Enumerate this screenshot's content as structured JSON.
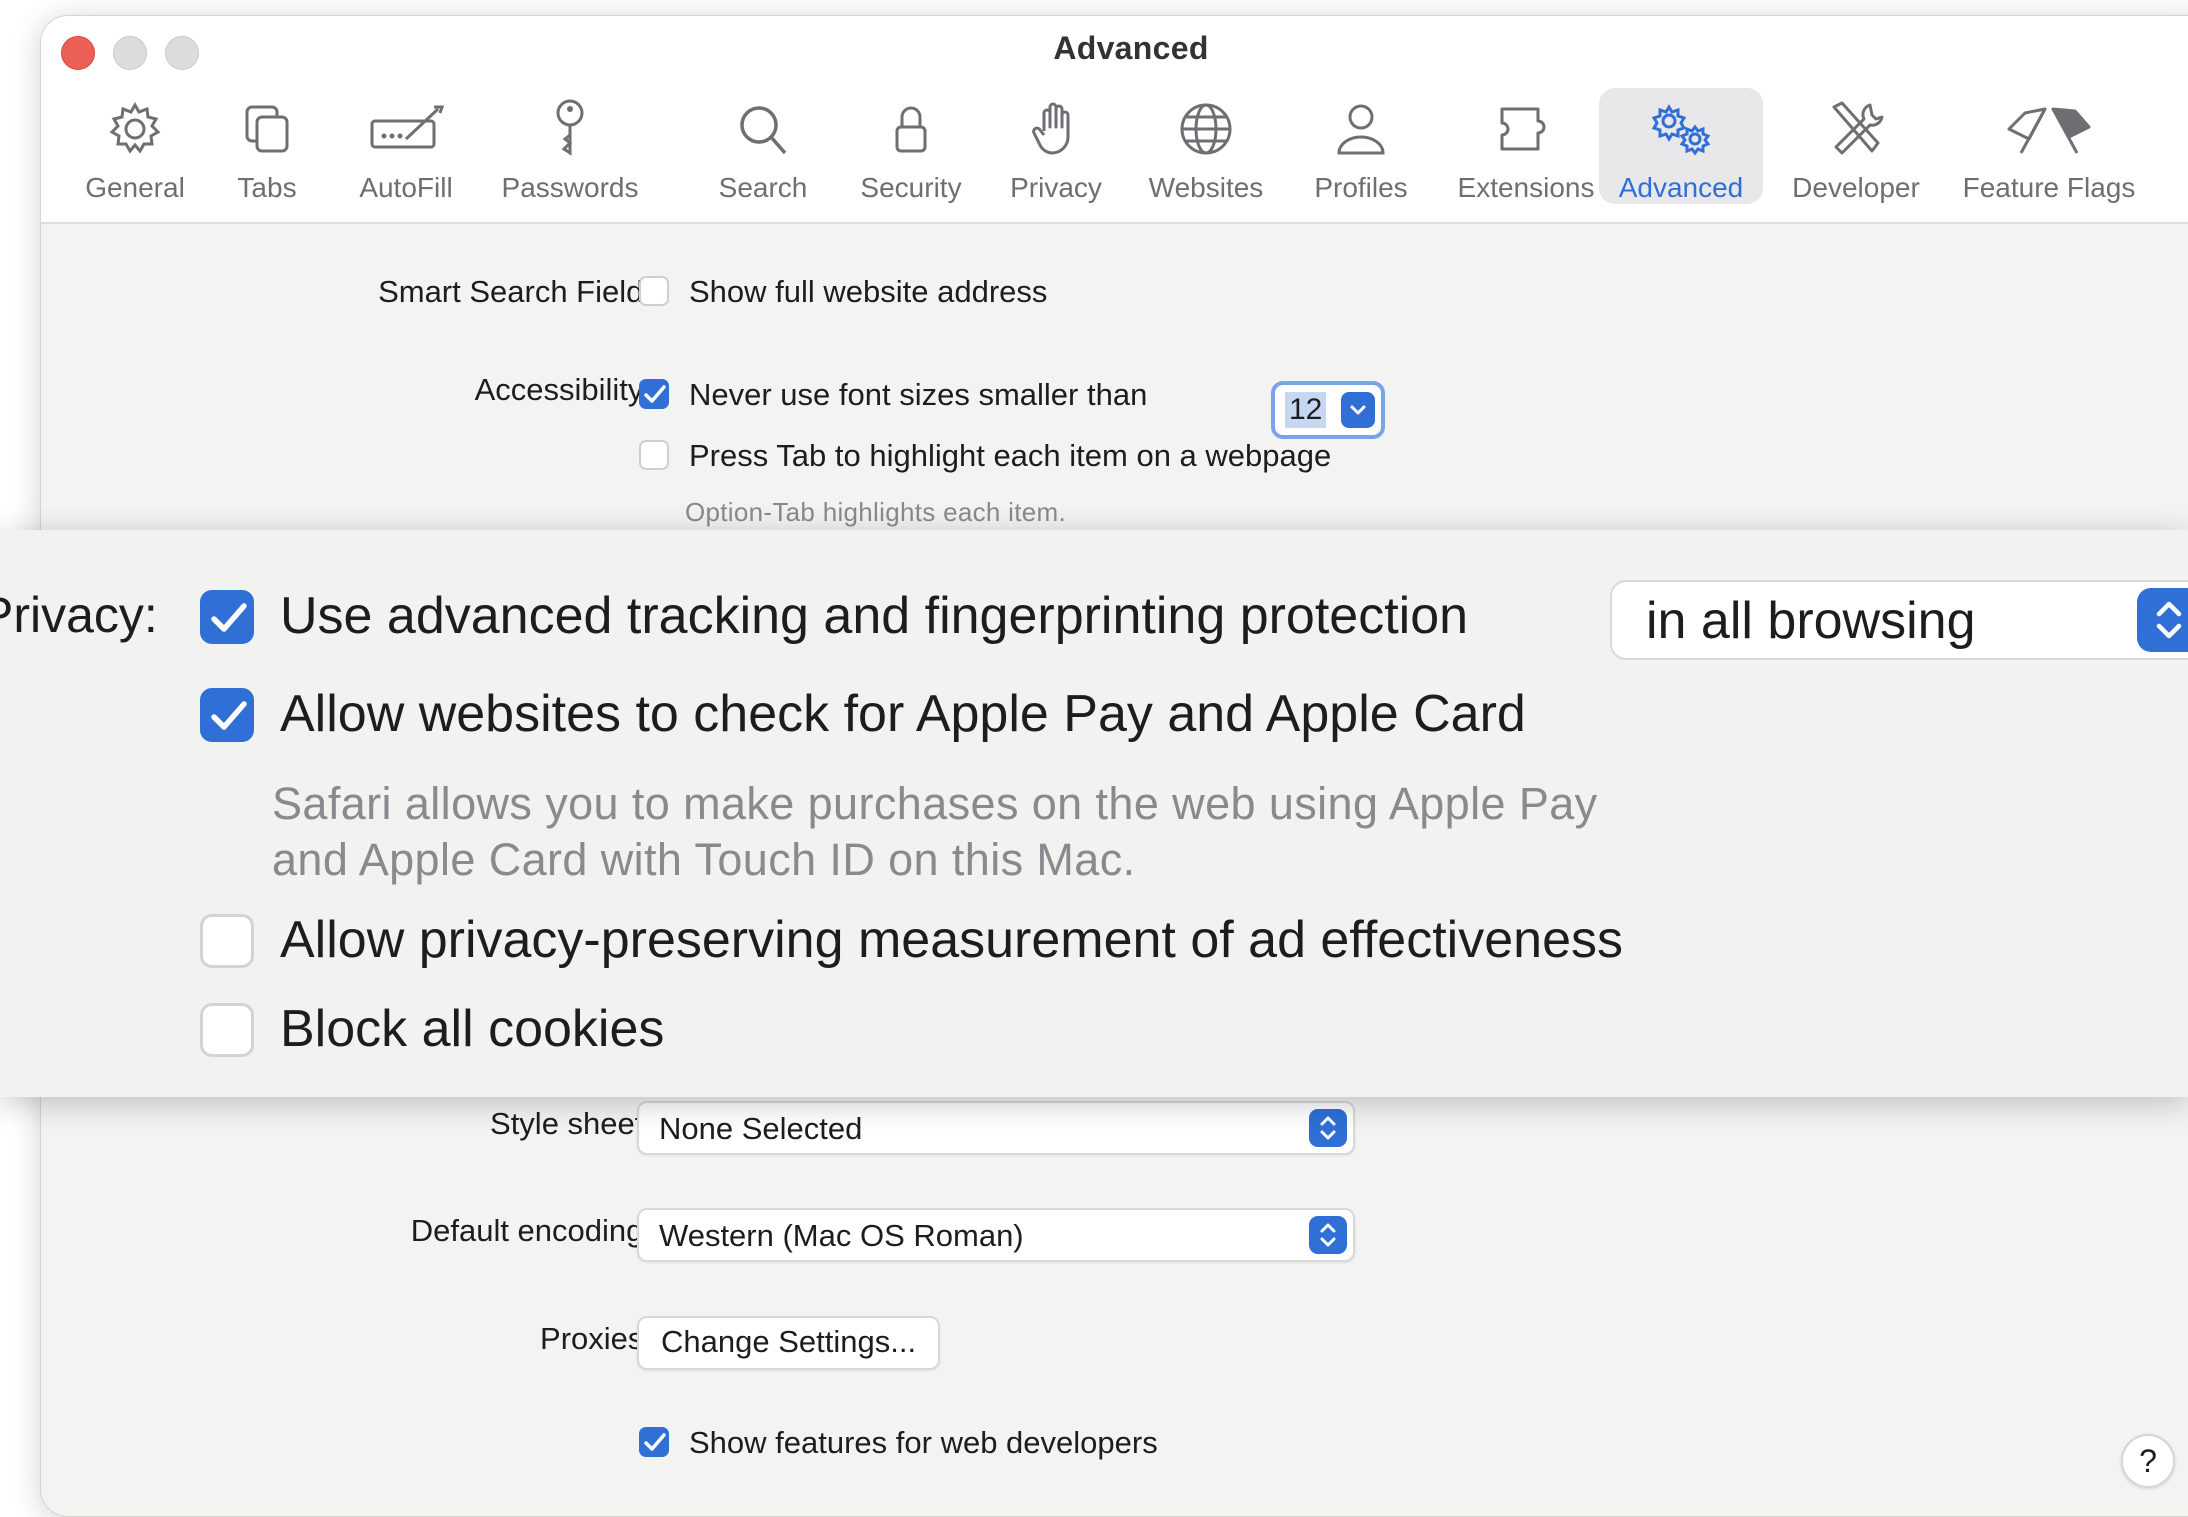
{
  "window": {
    "title": "Advanced"
  },
  "toolbar": {
    "items": [
      {
        "label": "General",
        "icon": "gear-icon"
      },
      {
        "label": "Tabs",
        "icon": "tabs-icon"
      },
      {
        "label": "AutoFill",
        "icon": "autofill-icon"
      },
      {
        "label": "Passwords",
        "icon": "key-icon"
      },
      {
        "label": "Search",
        "icon": "search-icon"
      },
      {
        "label": "Security",
        "icon": "lock-icon"
      },
      {
        "label": "Privacy",
        "icon": "hand-icon"
      },
      {
        "label": "Websites",
        "icon": "globe-icon"
      },
      {
        "label": "Profiles",
        "icon": "person-icon"
      },
      {
        "label": "Extensions",
        "icon": "puzzle-icon"
      },
      {
        "label": "Advanced",
        "icon": "gears-icon",
        "selected": true
      },
      {
        "label": "Developer",
        "icon": "tools-icon"
      },
      {
        "label": "Feature Flags",
        "icon": "flags-icon"
      }
    ],
    "accent_color": "#2f6fd6"
  },
  "smart_search": {
    "label": "Smart Search Field:",
    "option": "Show full website address",
    "checked": false
  },
  "accessibility": {
    "label": "Accessibility:",
    "min_font_option": "Never use font sizes smaller than",
    "min_font_checked": true,
    "min_font_value": "12",
    "press_tab_option": "Press Tab to highlight each item on a webpage",
    "press_tab_checked": false,
    "hint": "Option-Tab highlights each item."
  },
  "privacy": {
    "label": "Privacy:",
    "tracking_option": "Use advanced tracking and fingerprinting protection",
    "tracking_checked": true,
    "tracking_scope": "in all browsing",
    "apple_pay_option": "Allow websites to check for Apple Pay and Apple Card",
    "apple_pay_checked": true,
    "apple_pay_hint_1": "Safari allows you to make purchases on the web using Apple Pay",
    "apple_pay_hint_2": "and Apple Card with Touch ID on this Mac.",
    "ad_measurement_option": "Allow privacy-preserving measurement of ad effectiveness",
    "ad_measurement_checked": false,
    "block_cookies_option": "Block all cookies",
    "block_cookies_checked": false
  },
  "style_sheet": {
    "label": "Style sheet:",
    "value": "None Selected"
  },
  "encoding": {
    "label": "Default encoding:",
    "value": "Western (Mac OS Roman)"
  },
  "proxies": {
    "label": "Proxies:",
    "button": "Change Settings..."
  },
  "developer": {
    "option": "Show features for web developers",
    "checked": true
  },
  "help": {
    "label": "?"
  }
}
